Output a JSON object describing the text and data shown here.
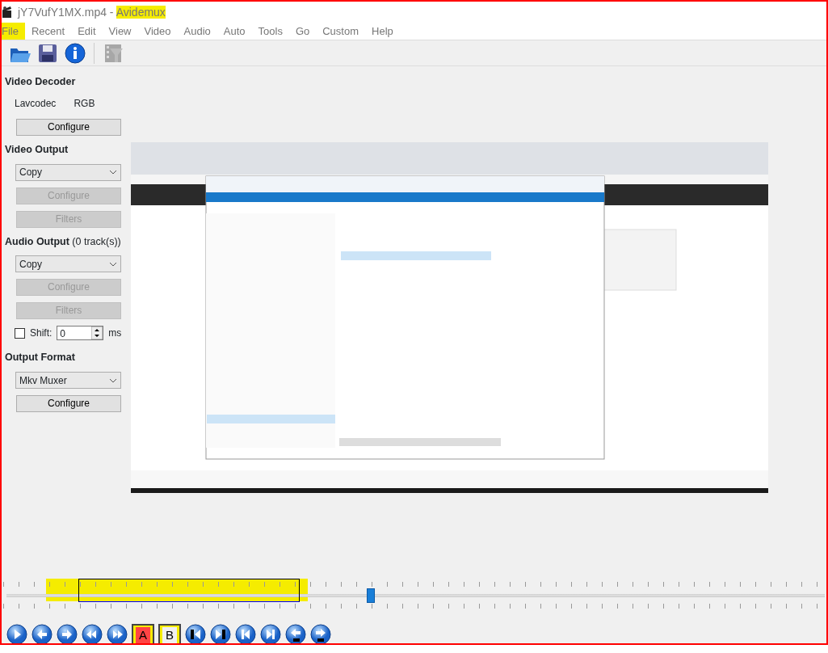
{
  "window": {
    "title_parts": [
      {
        "text": "jY7VufY1MX.mp4 -",
        "highlighted": false
      },
      {
        "text": "Avidemux",
        "highlighted": true
      }
    ]
  },
  "menu": [
    {
      "label": "File",
      "highlighted": true
    },
    {
      "label": "Recent",
      "highlighted": false
    },
    {
      "label": "Edit",
      "highlighted": false
    },
    {
      "label": "View",
      "highlighted": false
    },
    {
      "label": "Video",
      "highlighted": false
    },
    {
      "label": "Audio",
      "highlighted": false
    },
    {
      "label": "Auto",
      "highlighted": false
    },
    {
      "label": "Tools",
      "highlighted": false
    },
    {
      "label": "Go",
      "highlighted": false
    },
    {
      "label": "Custom",
      "highlighted": false
    },
    {
      "label": "Help",
      "highlighted": false
    }
  ],
  "toolbar": [
    {
      "kind": "open",
      "disabled": false
    },
    {
      "kind": "save",
      "disabled": false
    },
    {
      "kind": "info",
      "disabled": false
    },
    {
      "kind": "filters",
      "disabled": true
    }
  ],
  "sections": [
    {
      "title": "Video Decoder",
      "items": [
        {
          "kind": "pair",
          "texts": [
            "Lavcodec",
            "RGB"
          ]
        },
        {
          "kind": "button",
          "label": "Configure",
          "disabled": false
        }
      ]
    },
    {
      "title": "Video Output",
      "items": [
        {
          "kind": "select",
          "value": "Copy"
        },
        {
          "kind": "button",
          "label": "Configure",
          "disabled": true
        },
        {
          "kind": "button",
          "label": "Filters",
          "disabled": true
        }
      ]
    },
    {
      "title": "Audio Output",
      "note": "(0 track(s))",
      "items": [
        {
          "kind": "select",
          "value": "Copy"
        },
        {
          "kind": "button",
          "label": "Configure",
          "disabled": true
        },
        {
          "kind": "button",
          "label": "Filters",
          "disabled": true
        },
        {
          "kind": "shift",
          "label": "Shift:",
          "checked": false,
          "value": "0",
          "unit": "ms"
        }
      ]
    },
    {
      "title": "Output Format",
      "items": [
        {
          "kind": "select",
          "value": "Mkv Muxer"
        },
        {
          "kind": "button",
          "label": "Configure",
          "disabled": false
        }
      ]
    }
  ],
  "timeline": {
    "level": 0.44,
    "selection_highlighted": true
  },
  "controls": [
    {
      "kind": "play"
    },
    {
      "kind": "back"
    },
    {
      "kind": "forward"
    },
    {
      "kind": "rewind"
    },
    {
      "kind": "fast-forward"
    },
    {
      "kind": "marker",
      "label": "A",
      "highlighted": true
    },
    {
      "kind": "marker",
      "label": "B",
      "highlighted": true
    },
    {
      "kind": "start"
    },
    {
      "kind": "end"
    },
    {
      "kind": "prev-key"
    },
    {
      "kind": "next-key"
    },
    {
      "kind": "back-black"
    },
    {
      "kind": "forward-black"
    }
  ]
}
